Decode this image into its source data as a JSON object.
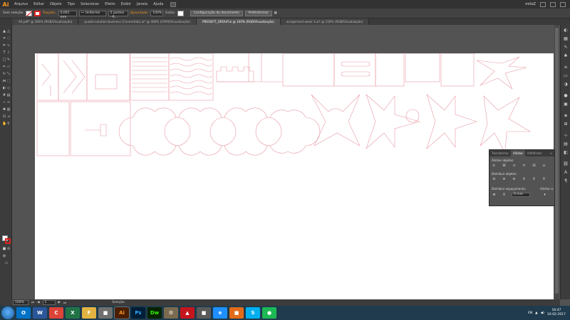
{
  "app": {
    "logo": "Ai",
    "user": "mitoZ"
  },
  "menu": [
    "Arquivo",
    "Editar",
    "Objeto",
    "Tipo",
    "Selecionar",
    "Efeito",
    "Exibir",
    "Janela",
    "Ajuda"
  ],
  "control": {
    "selection": "Sem seleção",
    "stroke_label": "Traçado:",
    "stroke_value": "0,001 mm",
    "profile": "Uniforme",
    "brush": "5 pontos - R...",
    "opacity_label": "Opacidade:",
    "opacity_value": "100%",
    "style_label": "Estilo:",
    "doc_setup": "Configuração do documento",
    "prefs": "Preferências"
  },
  "tabs": [
    {
      "label": "AS.pdf* @ 300% (RGB/Visualização)",
      "active": false
    },
    {
      "label": "puzzle-solution-business (Convertido).ai* @ 400% (CMYK/Visualização)",
      "active": false
    },
    {
      "label": "PRESSFIT_GROUP.ai @ 100% (RGB/Visualização)",
      "active": true
    },
    {
      "label": "assignment week 3.ai* @ 150% (RGB/Visualização)",
      "active": false
    }
  ],
  "status": {
    "zoom": "100%",
    "page": "1",
    "tool": "Seleção"
  },
  "panel": {
    "tabs": [
      "Transformar",
      "Alinhar",
      "Pathfinder"
    ],
    "active_tab": "Alinhar",
    "align_objects": "Alinhar objetos:",
    "distribute_objects": "Distribuir objetos:",
    "distribute_spacing": "Distribuir espaçamento:",
    "align_to": "Alinhar a:",
    "spacing_value": "0 mm"
  },
  "taskbar": {
    "apps": [
      "O",
      "W",
      "C",
      "X",
      "F",
      "■",
      "Ai",
      "Ps",
      "Dw",
      "⚙",
      "▲",
      "■",
      "e",
      "■",
      "S",
      "●"
    ],
    "lang": "EN",
    "time": "16:47",
    "date": "10-02-2017"
  },
  "colors": {
    "accent": "#f7941d",
    "cut_lines": "#e89aa5"
  }
}
